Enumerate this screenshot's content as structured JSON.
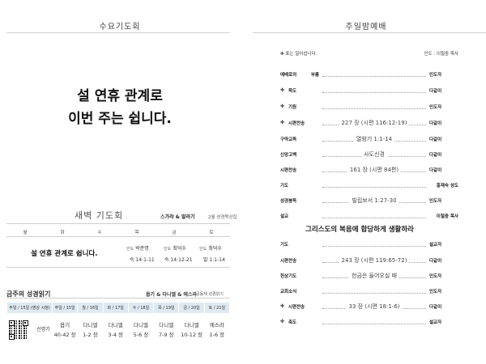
{
  "wednesday": {
    "title": "수요기도회",
    "notice_line1": "설 연휴 관계로",
    "notice_line2": "이번 주는 쉽니다."
  },
  "dawn": {
    "title": "새벽 기도회",
    "book_label": "스가랴 & 말라기",
    "book_note": "2월 성경묵상집",
    "days": [
      "월",
      "화",
      "수",
      "목",
      "금",
      "토"
    ],
    "notice": "설 연휴 관계로 쉽니다.",
    "cells": [
      {
        "pre": "인도",
        "leader": "박준명",
        "passage": "슥 14:1-11"
      },
      {
        "pre": "인도",
        "leader": "최덕수",
        "passage": "슥 14:12-21"
      },
      {
        "pre": "인도",
        "leader": "최덕수",
        "passage": "말 1:1-14"
      }
    ]
  },
  "bible_reading": {
    "title": "금주의 성경읽기",
    "label": "욥기 & 다니엘 & 에스라",
    "sub": "공동체 성경읽기",
    "header_first": "주일 / 15일 (영상 시청)",
    "headers": [
      "주일 / 15일",
      "월 / 16일",
      "화 / 17일",
      "수 / 18일",
      "목 / 19일",
      "금 / 20일",
      "토 / 21일"
    ],
    "qr_label": "신명기",
    "cells": [
      {
        "book": "욥기",
        "range": "40-42 장"
      },
      {
        "book": "다니엘",
        "range": "1-2 장"
      },
      {
        "book": "다니엘",
        "range": "3-4 장"
      },
      {
        "book": "다니엘",
        "range": "5-6 장"
      },
      {
        "book": "다니엘",
        "range": "7-9 장"
      },
      {
        "book": "다니엘",
        "range": "10-12 장"
      },
      {
        "book": "에스라",
        "range": "1-6 장"
      }
    ]
  },
  "sunday": {
    "title": "주일밤예배",
    "note": "✤ 표는 일어섭니다.",
    "leader": "인도 : 이철중 목사",
    "order": [
      {
        "star": false,
        "label": "예배로의 부름",
        "content": "",
        "person": "인도자"
      },
      {
        "star": true,
        "label": "묵도",
        "content": "",
        "person": "다같이"
      },
      {
        "star": true,
        "label": "기원",
        "content": "",
        "person": "인도자"
      },
      {
        "star": true,
        "label": "시편찬송",
        "content": "227 장 (시편 116:12-19)",
        "person": "다같이"
      },
      {
        "star": false,
        "label": "구약교독",
        "content": "열왕기 1:1-14",
        "person": "다같이"
      },
      {
        "star": false,
        "label": "신앙고백",
        "content": "사도신경",
        "person": "다같이"
      },
      {
        "star": false,
        "label": "시편찬송",
        "content": "161 장 (시편 84편)",
        "person": "다같이"
      },
      {
        "star": false,
        "label": "기도",
        "content": "",
        "person": "홍재숙 성도"
      },
      {
        "star": false,
        "label": "성경봉독",
        "content": "빌립보서 1:27-30",
        "person": "인도자"
      },
      {
        "star": false,
        "label": "설교",
        "content": "",
        "person": "이철중 목사"
      },
      {
        "star": false,
        "label": "기도",
        "content": "",
        "person": "설교자"
      },
      {
        "star": false,
        "label": "시편찬송",
        "content": "243 장 (시편 119:65-72)",
        "person": "다같이"
      },
      {
        "star": false,
        "label": "헌상기도",
        "content": "헌금은 들어오실 때",
        "person": "인도자"
      },
      {
        "star": false,
        "label": "교회소식",
        "content": "",
        "person": "인도자"
      },
      {
        "star": true,
        "label": "시편찬송",
        "content": "33 장 (시편 18:1-6)",
        "person": "다같이"
      },
      {
        "star": true,
        "label": "축도",
        "content": "",
        "person": "설교자"
      }
    ],
    "sermon_title": "그리스도의 복음에 합당하게 생활하라"
  }
}
